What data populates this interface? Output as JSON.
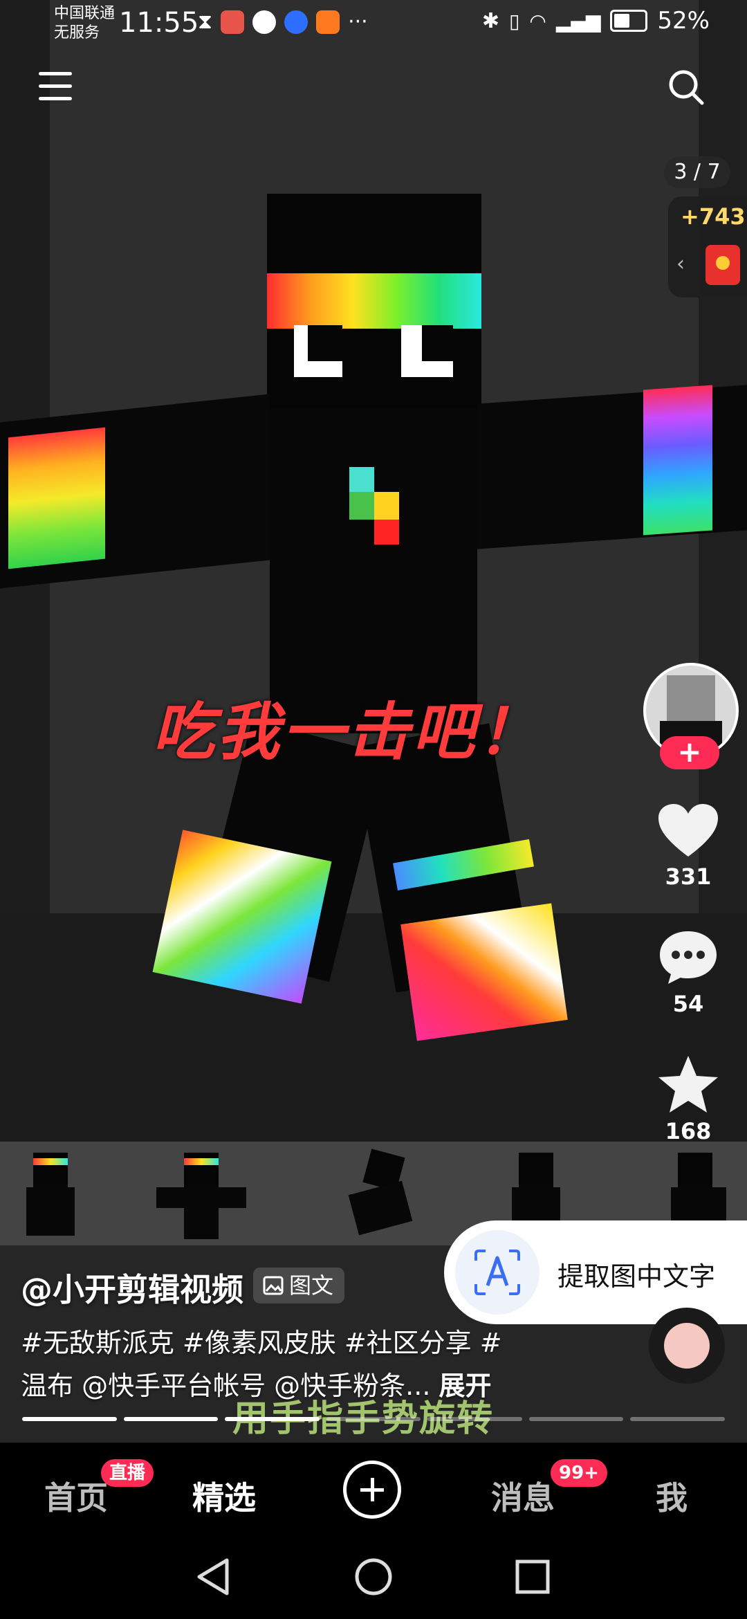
{
  "status_bar": {
    "carrier_line1": "中国联通",
    "carrier_line2": "无服务",
    "time": "11:55",
    "more": "···",
    "battery": "52%"
  },
  "viewer": {
    "page_indicator": "3 / 7",
    "coins": "+743",
    "overlay_text": "吃我一击吧！"
  },
  "actions": {
    "follow": "+",
    "likes": "331",
    "comments": "54",
    "favorites": "168"
  },
  "ocr_popup": {
    "label": "提取图中文字"
  },
  "post": {
    "author": "@小开剪辑视频",
    "type_badge": "图文",
    "caption_line1": "#无敌斯派克 #像素风皮肤 #社区分享 #",
    "caption_line2": "温布 @快手平台帐号 @快手粉条...",
    "expand": "展开",
    "gesture_hint": "用手指手势旋转",
    "progress": {
      "current": 3,
      "total": 7
    }
  },
  "bottom_nav": {
    "home": "首页",
    "home_badge": "直播",
    "featured": "精选",
    "messages": "消息",
    "messages_badge": "99+",
    "me": "我"
  },
  "colors": {
    "accent": "#fe2c55",
    "slogan": "#ff3b3b",
    "coin": "#ffd86b"
  }
}
